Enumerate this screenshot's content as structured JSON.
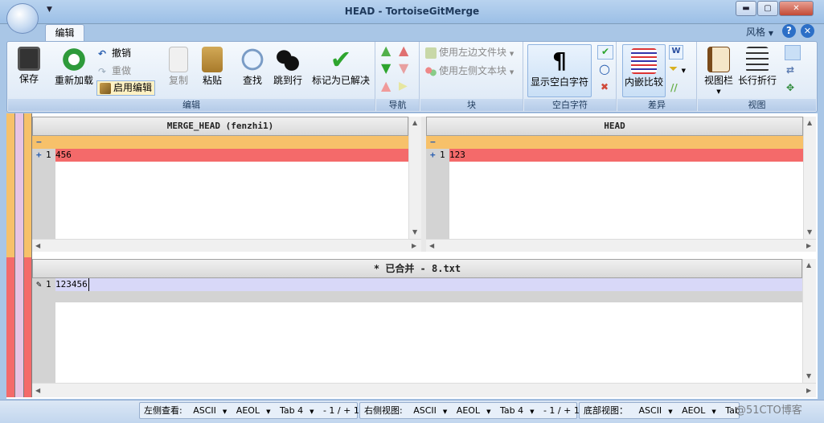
{
  "window": {
    "title": "HEAD - TortoiseGitMerge",
    "min_label": "▬",
    "max_label": "▢",
    "close_label": "✕"
  },
  "ribbon": {
    "tabs": [
      {
        "label": "编辑"
      }
    ],
    "style_label": "风格",
    "groups": {
      "edit": {
        "label": "编辑",
        "save": "保存",
        "reload": "重新加载",
        "undo": "撤销",
        "redo": "重做",
        "enable_edit": "启用编辑",
        "copy": "复制",
        "paste": "粘贴",
        "find": "查找",
        "goto_line": "跳到行",
        "mark_resolved": "标记为已解决"
      },
      "nav": {
        "label": "导航"
      },
      "block": {
        "label": "块",
        "use_left_file_block": "使用左边文件块",
        "use_left_text_block": "使用左侧文本块"
      },
      "whitespace": {
        "label": "空白字符",
        "show_whitespace": "显示空白字符"
      },
      "diff": {
        "label": "差异",
        "inline_diff": "内嵌比较"
      },
      "view": {
        "label": "视图",
        "view_bar": "视图栏",
        "wrap_long_lines": "长行折行"
      }
    }
  },
  "panes": {
    "left": {
      "header": "MERGE_HEAD (fenzhi1)",
      "lines": [
        {
          "marker": "−",
          "num": "",
          "text": ""
        },
        {
          "marker": "+",
          "num": "1",
          "text": "456"
        }
      ]
    },
    "right": {
      "header": "HEAD",
      "lines": [
        {
          "marker": "−",
          "num": "",
          "text": ""
        },
        {
          "marker": "+",
          "num": "1",
          "text": "123"
        }
      ]
    },
    "bottom": {
      "header": "* 已合并 - 8.txt",
      "lines": [
        {
          "marker": "✎",
          "num": "1",
          "text": "123456"
        }
      ]
    }
  },
  "status": {
    "left": {
      "label": "左侧查看:",
      "encoding": "ASCII",
      "eol": "AEOL",
      "tab": "Tab 4",
      "diff": "- 1 / + 1"
    },
    "right": {
      "label": "右侧视图:",
      "encoding": "ASCII",
      "eol": "AEOL",
      "tab": "Tab 4",
      "diff": "- 1 / + 1"
    },
    "bottom": {
      "label": "底部视图：",
      "encoding": "ASCII",
      "eol": "AEOL",
      "tab": "Tab"
    },
    "watermark": "@51CTO博客"
  },
  "colors": {
    "removed_line": "#f46a6a",
    "conflict_header": "#f7c16a",
    "edited_line": "#d8d8f8",
    "accent": "#2c6fc7"
  }
}
